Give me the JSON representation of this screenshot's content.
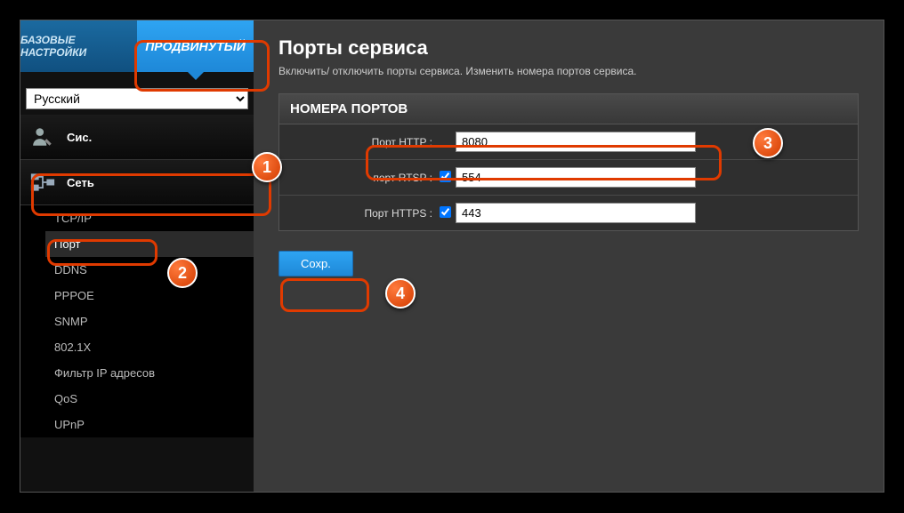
{
  "tabs": {
    "basic": "БАЗОВЫЕ НАСТРОЙКИ",
    "advanced": "ПРОДВИНУТЫЙ"
  },
  "language": {
    "selected": "Русский",
    "options": [
      "Русский"
    ]
  },
  "sidebar": {
    "system_label": "Сис.",
    "network_label": "Сеть",
    "items": [
      {
        "label": "TCP/IP"
      },
      {
        "label": "Порт"
      },
      {
        "label": "DDNS"
      },
      {
        "label": "PPPOE"
      },
      {
        "label": "SNMP"
      },
      {
        "label": "802.1X"
      },
      {
        "label": "Фильтр IP адресов"
      },
      {
        "label": "QoS"
      },
      {
        "label": "UPnP"
      }
    ]
  },
  "main": {
    "title": "Порты сервиса",
    "subtitle": "Включить/ отключить порты сервиса. Изменить номера портов сервиса.",
    "section_title": "НОМЕРА ПОРТОВ",
    "rows": [
      {
        "label": "Порт HTTP :",
        "value": "8080",
        "checkbox": false
      },
      {
        "label": "порт RTSP :",
        "value": "554",
        "checkbox": true,
        "checked": true
      },
      {
        "label": "Порт HTTPS :",
        "value": "443",
        "checkbox": true,
        "checked": true
      }
    ],
    "save_label": "Сохр."
  },
  "markers": {
    "1": "1",
    "2": "2",
    "3": "3",
    "4": "4"
  }
}
